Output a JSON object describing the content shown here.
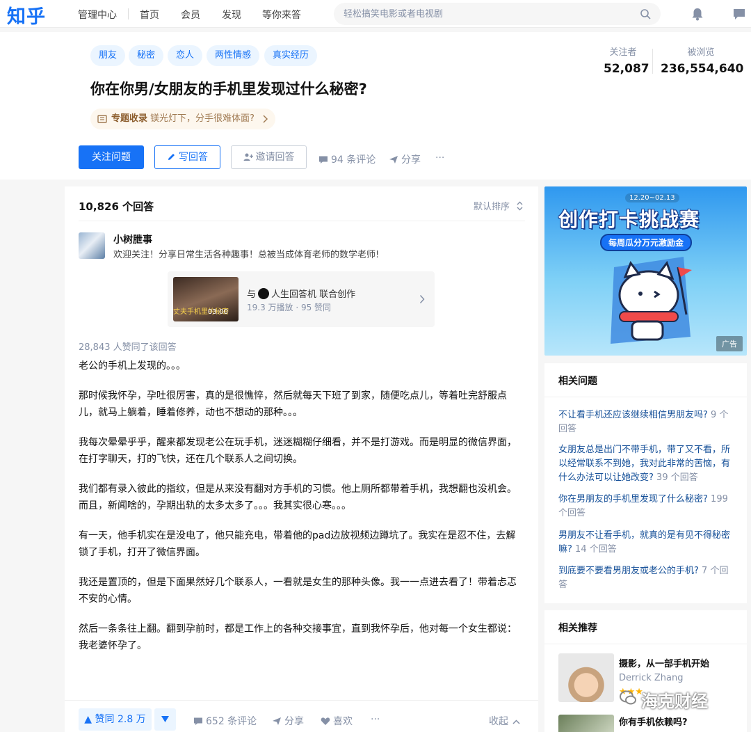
{
  "nav": {
    "logo": "知乎",
    "items": [
      "管理中心",
      "首页",
      "会员",
      "发现",
      "等你来答"
    ],
    "search_placeholder": "轻松搞笑电影或者电视剧"
  },
  "question": {
    "tags": [
      "朋友",
      "秘密",
      "恋人",
      "两性情感",
      "真实经历"
    ],
    "title": "你在你男/女朋友的手机里发现过什么秘密?",
    "collection_label": "专题收录",
    "collection_text": "镁光灯下，分手很难体面?",
    "followers_label": "关注者",
    "followers_value": "52,087",
    "views_label": "被浏览",
    "views_value": "236,554,640",
    "follow_button": "关注问题",
    "write_button": "写回答",
    "invite_button": "邀请回答",
    "comments": "94 条评论",
    "share": "分享",
    "more": "···"
  },
  "answers": {
    "count": "10,826 个回答",
    "sort": "默认排序",
    "author_name": "小树朑事",
    "author_bio": "欢迎关注！分享日常生活各种趣事！总被当成体育老师的数学老师!",
    "video_prefix": "与",
    "video_partner": "人生回答机 联合创作",
    "video_stats": "19.3 万播放 · 95 赞同",
    "video_caption": "丈夫手机里的秘密",
    "video_duration": "03:00",
    "vote_line": "28,843 人赞同了该回答",
    "paragraphs": [
      "老公的手机上发现的。。。",
      "那时候我怀孕，孕吐很厉害，真的是很憔悴，然后就每天下班了到家，随便吃点儿，等着吐完舒服点儿，就马上躺着，睡着修养，动也不想动的那种。。。",
      "我每次晕晕乎乎，醒来都发现老公在玩手机，迷迷糊糊仔细看，并不是打游戏。而是明显的微信界面，在打字聊天，打的飞快，还在几个联系人之间切换。",
      "我们都有录入彼此的指纹，但是从来没有翻对方手机的习惯。他上厕所都带着手机，我想翻也没机会。而且，新闻啥的，孕期出轨的太多太多了。。。我其实很心寒。。。",
      "有一天，他手机实在是没电了，他只能充电，带着他的pad边放视频边蹲坑了。我实在是忍不住，去解锁了手机，打开了微信界面。",
      "我还是置顶的，但是下面果然好几个联系人，一看就是女生的那种头像。我一一点进去看了！带着忐忑不安的心情。",
      "然后一条条往上翻。翻到孕前时，都是工作上的各种交接事宜，直到我怀孕后，他对每一个女生都说：我老婆怀孕了。"
    ],
    "footer": {
      "vote": "▲ 赞同 2.8 万",
      "comments": "652 条评论",
      "share": "分享",
      "like": "喜欢",
      "more": "···",
      "collapse": "收起"
    }
  },
  "ad": {
    "date": "12.20~02.13",
    "title": "创作打卡挑战赛",
    "pill": "每周瓜分万元激励金",
    "badge": "广告"
  },
  "related": {
    "title": "相关问题",
    "items": [
      {
        "q": "不让看手机还应该继续相信男朋友吗?",
        "c": "9 个回答"
      },
      {
        "q": "女朋友总是出门不带手机，带了又不看，所以经常联系不到她，我对此非常的苦恼，有什么办法可以让她改变?",
        "c": "39 个回答"
      },
      {
        "q": "你在男朋友的手机里发现了什么秘密?",
        "c": "199 个回答"
      },
      {
        "q": "男朋友不让看手机，就真的是有见不得秘密嘛?",
        "c": "14 个回答"
      },
      {
        "q": "到底要不要看男朋友或老公的手机?",
        "c": "7 个回答"
      }
    ]
  },
  "recommend": {
    "title": "相关推荐",
    "item1_title": "摄影，从一部手机开始",
    "item1_author": "Derrick Zhang",
    "item1_stars": "★★★",
    "item2_title": "你有手机依赖吗?"
  },
  "watermark": "海克财经",
  "colors": {
    "brand": "#1772f6",
    "link": "#175199",
    "muted": "#8590a6"
  }
}
